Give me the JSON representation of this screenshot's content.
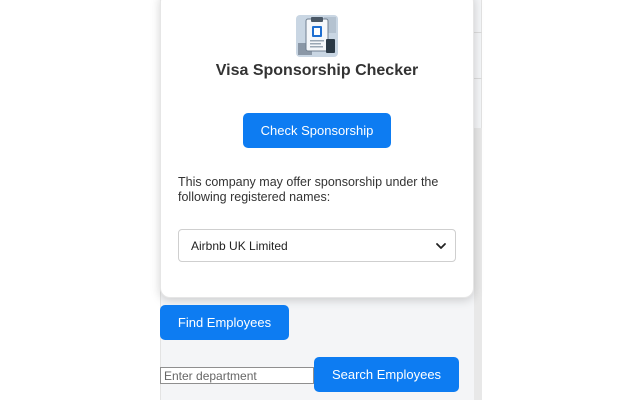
{
  "popup": {
    "title": "Visa Sponsorship Checker",
    "check_button_label": "Check Sponsorship",
    "description": "This company may offer sponsorship under the following registered names:",
    "company_select": {
      "selected": "Airbnb UK Limited"
    },
    "logo_icon": "visa-document-icon"
  },
  "actions": {
    "find_employees_label": "Find Employees",
    "department_placeholder": "Enter department",
    "search_employees_label": "Search Employees"
  },
  "colors": {
    "accent": "#0d7cf2"
  }
}
